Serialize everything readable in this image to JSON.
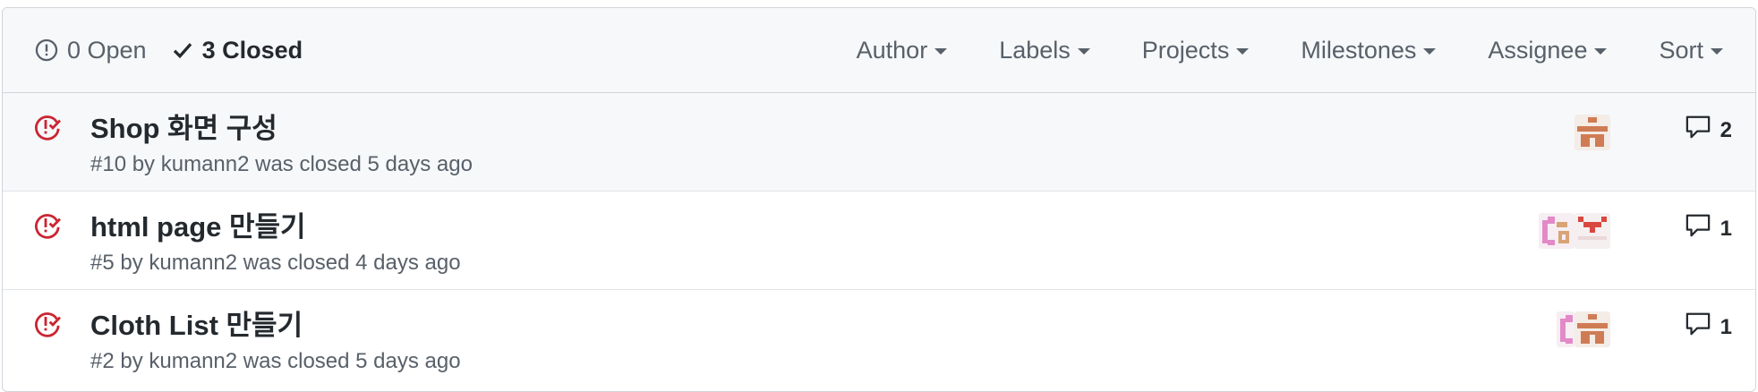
{
  "header": {
    "open_count_label": "0 Open",
    "closed_count_label": "3 Closed",
    "filters": [
      "Author",
      "Labels",
      "Projects",
      "Milestones",
      "Assignee",
      "Sort"
    ]
  },
  "issues": [
    {
      "title": "Shop 화면 구성",
      "meta": "#10 by kumann2 was closed 5 days ago",
      "comments": "2",
      "assignee_icons": [
        "identicon-brown"
      ]
    },
    {
      "title": "html page 만들기",
      "meta": "#5 by kumann2 was closed 4 days ago",
      "comments": "1",
      "assignee_icons": [
        "identicon-pink",
        "identicon-red"
      ]
    },
    {
      "title": "Cloth List 만들기",
      "meta": "#2 by kumann2 was closed 5 days ago",
      "comments": "1",
      "assignee_icons": [
        "identicon-pink",
        "identicon-brown"
      ]
    }
  ],
  "colors": {
    "closed_icon": "#cb2431",
    "muted_text": "#586069",
    "header_bg": "#f6f8fa",
    "border": "#d1d5da"
  }
}
